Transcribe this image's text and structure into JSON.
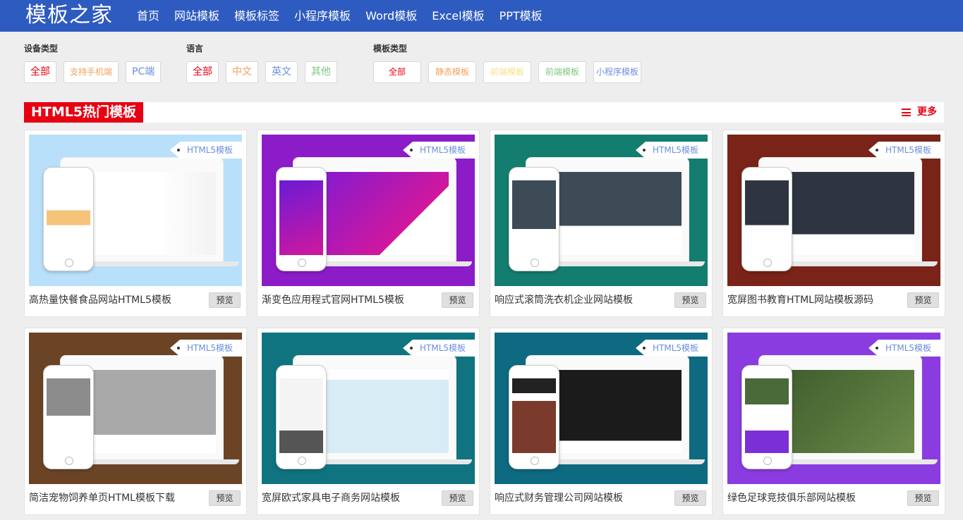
{
  "header": {
    "logo": "模板之家",
    "nav": [
      "首页",
      "网站模板",
      "模板标签",
      "小程序模板",
      "Word模板",
      "Excel模板",
      "PPT模板"
    ]
  },
  "filters": {
    "device": {
      "label": "设备类型",
      "options": [
        "全部",
        "支持手机端",
        "PC端"
      ]
    },
    "language": {
      "label": "语言",
      "options": [
        "全部",
        "中文",
        "英文",
        "其他"
      ]
    },
    "template_type": {
      "label": "模板类型",
      "options": [
        "全部",
        "静态模板",
        "前端模板",
        "前端模板",
        "小程序模板"
      ]
    }
  },
  "section": {
    "title": "HTML5热门模板",
    "more": "更多"
  },
  "cards": [
    {
      "tag": "HTML5模板",
      "title": "高热量快餐食品网站HTML5模板",
      "preview": "预览",
      "bg": "#b9e0fb"
    },
    {
      "tag": "HTML5模板",
      "title": "渐变色应用程式官网HTML5模板",
      "preview": "预览",
      "bg": "#8c1bc8"
    },
    {
      "tag": "HTML5模板",
      "title": "响应式滚筒洗衣机企业网站模板",
      "preview": "预览",
      "bg": "#137d6f"
    },
    {
      "tag": "HTML5模板",
      "title": "宽屏图书教育HTML网站模板源码",
      "preview": "预览",
      "bg": "#7a2318"
    },
    {
      "tag": "HTML5模板",
      "title": "简洁宠物饲养单页HTML模板下载",
      "preview": "预览",
      "bg": "#6b4426"
    },
    {
      "tag": "HTML5模板",
      "title": "宽屏欧式家具电子商务网站模板",
      "preview": "预览",
      "bg": "#0f7480"
    },
    {
      "tag": "HTML5模板",
      "title": "响应式财务管理公司网站模板",
      "preview": "预览",
      "bg": "#0d6a80"
    },
    {
      "tag": "HTML5模板",
      "title": "绿色足球竞技俱乐部网站模板",
      "preview": "预览",
      "bg": "#8a3ce0"
    }
  ],
  "colors": {
    "header": "#2e5bbf",
    "accent": "#e60012",
    "opt_colors": [
      "#e60012",
      "#f0a35a",
      "#6b8ee0",
      "#e60012",
      "#f0a35a",
      "#6b8ee0",
      "#7fc77f",
      "#e60012",
      "#f0a35a",
      "#f5e08a",
      "#7fc77f",
      "#6b8ee0"
    ]
  }
}
